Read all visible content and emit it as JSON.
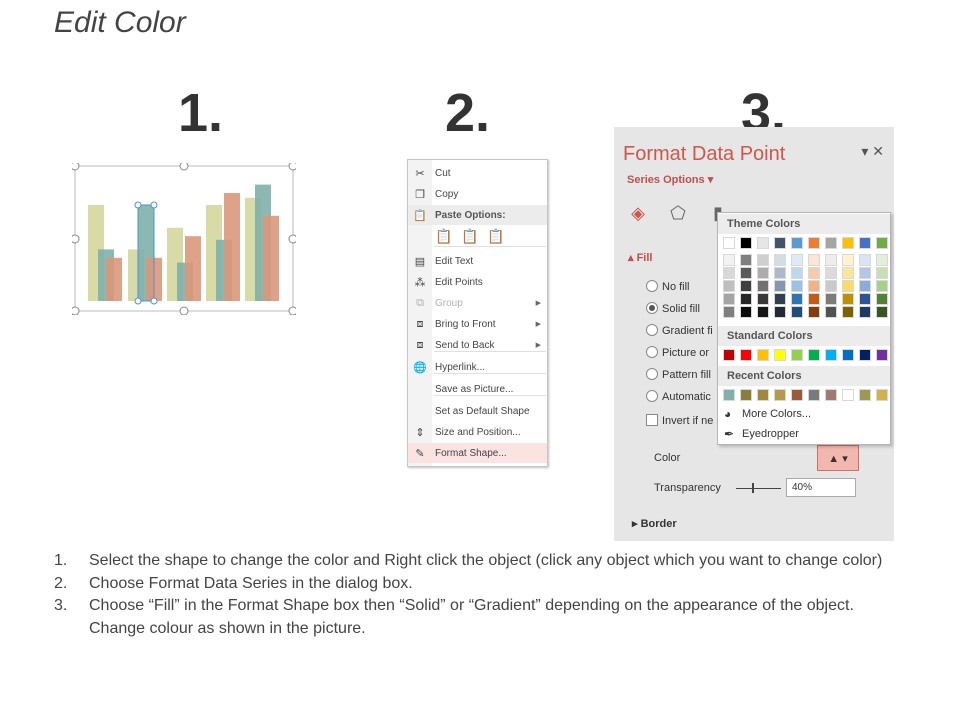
{
  "title": "Edit Color",
  "steps": [
    "1.",
    "2.",
    "3."
  ],
  "chart1": {
    "type": "bar",
    "series_colors": [
      "#d4d79b",
      "#7fb0ab",
      "#d9987a"
    ],
    "series": [
      {
        "values": [
          0.8,
          0.43,
          0.61,
          0.8,
          0.86
        ]
      },
      {
        "values": [
          0.43,
          0.8,
          0.32,
          0.51,
          0.97
        ]
      },
      {
        "values": [
          0.36,
          0.36,
          0.54,
          0.9,
          0.71
        ]
      }
    ],
    "selected_bar": "series 2, category 2"
  },
  "context_menu": {
    "items": [
      {
        "label": "Cut",
        "icon": "scissors-icon",
        "glyph": "✂"
      },
      {
        "label": "Copy",
        "icon": "copy-icon",
        "glyph": "❐"
      },
      {
        "label": "Paste Options:",
        "icon": "paste-icon",
        "glyph": "📋",
        "header": true
      },
      {
        "label": "Edit Text",
        "icon": "edit-text-icon",
        "glyph": "▤"
      },
      {
        "label": "Edit Points",
        "icon": "edit-points-icon",
        "glyph": "⁂"
      },
      {
        "label": "Group",
        "icon": "group-icon",
        "glyph": "⧉",
        "disabled": true,
        "submenu": true
      },
      {
        "label": "Bring to Front",
        "icon": "bring-front-icon",
        "glyph": "⧈",
        "submenu": true
      },
      {
        "label": "Send to Back",
        "icon": "send-back-icon",
        "glyph": "⧈",
        "submenu": true
      },
      {
        "label": "Hyperlink...",
        "icon": "hyperlink-icon",
        "glyph": "🌐"
      },
      {
        "label": "Save as Picture...",
        "icon": "",
        "glyph": ""
      },
      {
        "label": "Set as Default Shape",
        "icon": "",
        "glyph": ""
      },
      {
        "label": "Size and Position...",
        "icon": "size-position-icon",
        "glyph": "⇕"
      },
      {
        "label": "Format Shape...",
        "icon": "format-shape-icon",
        "glyph": "✎",
        "highlight": true
      }
    ]
  },
  "format_pane": {
    "title": "Format Data Point",
    "series_options": "Series Options ▾",
    "fill_section": "Fill",
    "fill_options": [
      {
        "label": "No fill",
        "selected": false
      },
      {
        "label": "Solid fill",
        "selected": true
      },
      {
        "label": "Gradient fi",
        "selected": false
      },
      {
        "label": "Picture or",
        "selected": false
      },
      {
        "label": "Pattern fill",
        "selected": false
      },
      {
        "label": "Automatic",
        "selected": false
      }
    ],
    "invert": "Invert if ne",
    "color_label": "Color",
    "transparency_label": "Transparency",
    "transparency_value": "40%",
    "border_section": "Border",
    "accent": "#d0564a"
  },
  "color_popup": {
    "theme_header": "Theme Colors",
    "standard_header": "Standard Colors",
    "recent_header": "Recent Colors",
    "more_colors": "More Colors...",
    "eyedropper": "Eyedropper",
    "theme_top": [
      "#ffffff",
      "#000000",
      "#e7e6e6",
      "#44546a",
      "#5b9bd5",
      "#ed7d31",
      "#a5a5a5",
      "#ffc000",
      "#4472c4",
      "#70ad47"
    ],
    "theme_shades": [
      [
        "#f2f2f2",
        "#7f7f7f",
        "#d0cece",
        "#d6dce4",
        "#deebf6",
        "#fbe5d5",
        "#ededed",
        "#fff2cc",
        "#dae3f3",
        "#e2efd9"
      ],
      [
        "#d8d8d8",
        "#595959",
        "#aeabab",
        "#adb9ca",
        "#bdd7ee",
        "#f7cbac",
        "#dbdbdb",
        "#fee599",
        "#b4c6e7",
        "#c5e0b3"
      ],
      [
        "#bfbfbf",
        "#3f3f3f",
        "#757070",
        "#8496b0",
        "#9cc3e5",
        "#f4b183",
        "#c9c9c9",
        "#ffd965",
        "#8eaadb",
        "#a8d08d"
      ],
      [
        "#a5a5a5",
        "#262626",
        "#3a3838",
        "#323f4f",
        "#2e75b5",
        "#c55a11",
        "#7b7b7b",
        "#bf9000",
        "#2f5496",
        "#538135"
      ],
      [
        "#7f7f7f",
        "#0c0c0c",
        "#171616",
        "#222a35",
        "#1e4e79",
        "#833c0b",
        "#525252",
        "#7f6000",
        "#1f3864",
        "#375623"
      ]
    ],
    "standard": [
      "#c00000",
      "#ff0000",
      "#ffc000",
      "#ffff00",
      "#92d050",
      "#00b050",
      "#00b0f0",
      "#0070c0",
      "#002060",
      "#7030a0"
    ],
    "recent": [
      "#7fb0ab",
      "#8b7d3a",
      "#a0883c",
      "#b79a48",
      "#9c5a3c",
      "#7a7a7a",
      "#a07a70",
      "#ffffff",
      "#9c9a50",
      "#d2b04a"
    ]
  },
  "instructions": [
    {
      "num": "1.",
      "text": "Select the shape to change the color and Right click the object (click any object which you want to change color)"
    },
    {
      "num": "2.",
      "text": "Choose Format Data Series in the dialog box."
    },
    {
      "num": "3.",
      "text": "Choose “Fill” in the Format Shape box then “Solid” or “Gradient” depending on the appearance of the object. Change colour as shown in the picture."
    }
  ]
}
